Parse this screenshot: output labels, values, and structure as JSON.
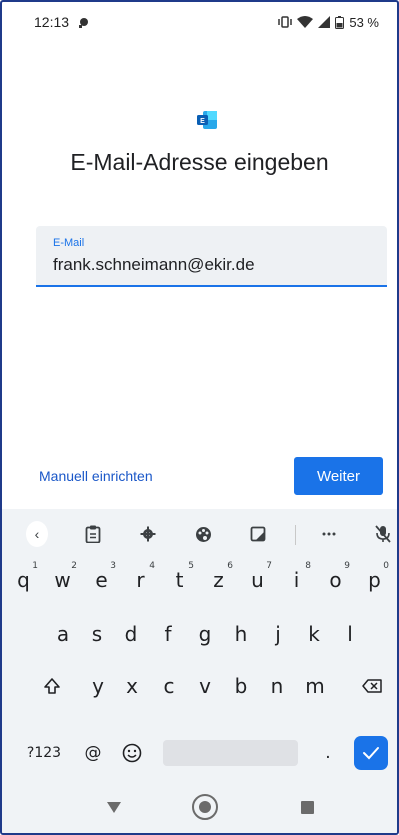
{
  "status": {
    "time": "12:13",
    "battery": "53 %"
  },
  "page": {
    "title": "E-Mail-Adresse eingeben"
  },
  "email": {
    "label": "E-Mail",
    "value": "frank.schneimann@ekir.de"
  },
  "actions": {
    "manual": "Manuell einrichten",
    "next": "Weiter"
  },
  "keyboard": {
    "row1": [
      {
        "k": "q",
        "n": "1"
      },
      {
        "k": "w",
        "n": "2"
      },
      {
        "k": "e",
        "n": "3"
      },
      {
        "k": "r",
        "n": "4"
      },
      {
        "k": "t",
        "n": "5"
      },
      {
        "k": "z",
        "n": "6"
      },
      {
        "k": "u",
        "n": "7"
      },
      {
        "k": "i",
        "n": "8"
      },
      {
        "k": "o",
        "n": "9"
      },
      {
        "k": "p",
        "n": "0"
      }
    ],
    "row2": [
      "a",
      "s",
      "d",
      "f",
      "g",
      "h",
      "j",
      "k",
      "l"
    ],
    "row3": [
      "y",
      "x",
      "c",
      "v",
      "b",
      "n",
      "m"
    ],
    "symbols": "?123",
    "at": "@",
    "dot": "."
  },
  "colors": {
    "accent": "#1a73e8",
    "link": "#1a57c8"
  }
}
